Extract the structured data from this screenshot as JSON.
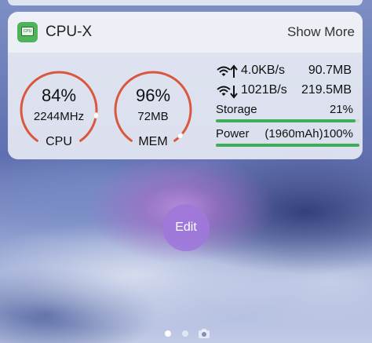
{
  "widget": {
    "app_icon_text": "CPU",
    "title": "CPU-X",
    "show_more": "Show More",
    "cpu": {
      "percent_text": "84%",
      "percent": 84,
      "frequency": "2244MHz",
      "label": "CPU"
    },
    "mem": {
      "percent_text": "96%",
      "percent": 96,
      "amount": "72MB",
      "label": "MEM"
    },
    "network": {
      "upload": {
        "icon": "wifi-up-icon",
        "rate": "4.0KB/s",
        "total": "90.7MB"
      },
      "download": {
        "icon": "wifi-down-icon",
        "rate": "1021B/s",
        "total": "219.5MB"
      }
    },
    "storage": {
      "label": "Storage",
      "value_text": "21%",
      "fill_fraction": 0.97
    },
    "power": {
      "label": "Power",
      "value_text": "(1960mAh)100%",
      "fill_fraction": 1.0
    }
  },
  "edit_button": {
    "label": "Edit"
  },
  "page_indicator": {
    "pages": 2,
    "current": 1,
    "extra_icon": "camera-icon"
  },
  "colors": {
    "gauge_arc": "#d9573f",
    "bar_fill": "#3fae5a",
    "edit_button": "#a078dc"
  }
}
